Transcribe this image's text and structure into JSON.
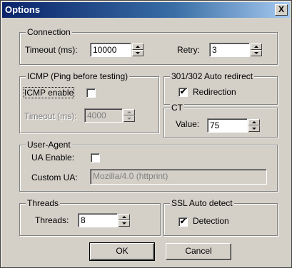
{
  "window": {
    "title": "Options",
    "close_glyph": "X"
  },
  "connection": {
    "legend": "Connection",
    "timeout_label": "Timeout (ms):",
    "timeout_value": "10000",
    "retry_label": "Retry:",
    "retry_value": "3"
  },
  "icmp": {
    "legend": "ICMP (Ping before testing)",
    "enable_label": "ICMP enable",
    "enable_checked": false,
    "timeout_label": "Timeout (ms):",
    "timeout_value": "4000"
  },
  "redirect": {
    "legend": "301/302 Auto redirect",
    "redirection_label": "Redirection",
    "redirection_checked": true
  },
  "ct": {
    "legend": "CT",
    "value_label": "Value:",
    "value": "75"
  },
  "useragent": {
    "legend": "User-Agent",
    "enable_label": "UA Enable:",
    "enable_checked": false,
    "custom_label": "Custom UA:",
    "custom_value": "Mozilla/4.0 (httprint)"
  },
  "threads": {
    "legend": "Threads",
    "threads_label": "Threads:",
    "threads_value": "8"
  },
  "ssl": {
    "legend": "SSL Auto detect",
    "detection_label": "Detection",
    "detection_checked": true
  },
  "buttons": {
    "ok": "OK",
    "cancel": "Cancel"
  },
  "check_glyph": "✔"
}
